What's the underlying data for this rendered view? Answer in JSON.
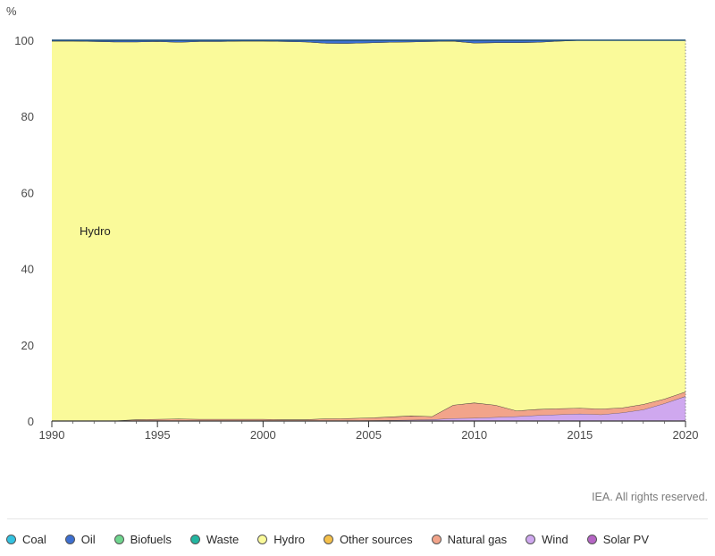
{
  "credit": "IEA. All rights reserved.",
  "chart_data": {
    "type": "area",
    "stacked": true,
    "ylabel": "%",
    "ylim": [
      0,
      100
    ],
    "yticks": [
      0,
      20,
      40,
      60,
      80,
      100
    ],
    "xlim": [
      1990,
      2020
    ],
    "xticks": [
      1990,
      1995,
      2000,
      2005,
      2010,
      2015,
      2020
    ],
    "x": [
      1990,
      1991,
      1992,
      1993,
      1994,
      1995,
      1996,
      1997,
      1998,
      1999,
      2000,
      2001,
      2002,
      2003,
      2004,
      2005,
      2006,
      2007,
      2008,
      2009,
      2010,
      2011,
      2012,
      2013,
      2014,
      2015,
      2016,
      2017,
      2018,
      2019,
      2020
    ],
    "annotation": "Hydro",
    "series": [
      {
        "name": "Solar PV",
        "color": "#b565c4",
        "values": [
          0,
          0,
          0,
          0,
          0,
          0,
          0,
          0,
          0,
          0,
          0,
          0,
          0,
          0,
          0,
          0,
          0,
          0,
          0,
          0,
          0,
          0,
          0,
          0,
          0,
          0,
          0,
          0,
          0,
          0.1,
          0.2
        ]
      },
      {
        "name": "Wind",
        "color": "#cfa8ef",
        "values": [
          0,
          0,
          0,
          0,
          0,
          0,
          0,
          0,
          0,
          0,
          0,
          0,
          0,
          0.05,
          0.1,
          0.15,
          0.2,
          0.3,
          0.4,
          0.7,
          0.8,
          1.0,
          1.2,
          1.5,
          1.7,
          1.9,
          1.7,
          2.2,
          3.0,
          4.5,
          6.3
        ]
      },
      {
        "name": "Natural gas",
        "color": "#f2a48a",
        "values": [
          0,
          0,
          0,
          0.1,
          0.4,
          0.5,
          0.6,
          0.5,
          0.5,
          0.5,
          0.5,
          0.4,
          0.4,
          0.6,
          0.6,
          0.7,
          0.9,
          1.1,
          0.8,
          3.5,
          4.0,
          3.2,
          1.5,
          1.6,
          1.6,
          1.5,
          1.5,
          1.3,
          1.4,
          1.2,
          1.2
        ]
      },
      {
        "name": "Other sources",
        "color": "#f5c04a",
        "values": [
          0,
          0,
          0,
          0,
          0,
          0,
          0,
          0,
          0,
          0,
          0,
          0,
          0,
          0,
          0,
          0,
          0,
          0,
          0,
          0,
          0,
          0,
          0,
          0,
          0,
          0,
          0,
          0,
          0,
          0,
          0
        ]
      },
      {
        "name": "Hydro",
        "color": "#fafa9a",
        "values": [
          99.8,
          99.8,
          99.7,
          99.5,
          99.2,
          99.2,
          98.9,
          99.2,
          99.2,
          99.3,
          99.3,
          99.3,
          99.2,
          98.6,
          98.5,
          98.5,
          98.4,
          98.2,
          98.5,
          95.6,
          94.5,
          95.2,
          96.7,
          96.4,
          96.5,
          96.6,
          96.8,
          96.5,
          95.6,
          94.2,
          92.3
        ]
      },
      {
        "name": "Waste",
        "color": "#22b5a0",
        "values": [
          0,
          0,
          0,
          0,
          0,
          0,
          0,
          0,
          0,
          0,
          0,
          0,
          0,
          0,
          0,
          0,
          0,
          0,
          0,
          0,
          0,
          0,
          0,
          0,
          0,
          0,
          0,
          0,
          0,
          0,
          0
        ]
      },
      {
        "name": "Biofuels",
        "color": "#6fd58e",
        "values": [
          0,
          0,
          0,
          0,
          0,
          0,
          0,
          0,
          0,
          0,
          0,
          0,
          0,
          0,
          0,
          0,
          0,
          0,
          0,
          0,
          0,
          0,
          0,
          0,
          0,
          0,
          0,
          0,
          0,
          0,
          0
        ]
      },
      {
        "name": "Oil",
        "color": "#3d6fd0",
        "values": [
          0.2,
          0.2,
          0.3,
          0.4,
          0.4,
          0.3,
          0.5,
          0.3,
          0.3,
          0.2,
          0.2,
          0.3,
          0.4,
          0.75,
          0.8,
          0.65,
          0.5,
          0.4,
          0.3,
          0.2,
          0.7,
          0.6,
          0.6,
          0.5,
          0.2,
          0,
          0,
          0,
          0,
          0,
          0
        ]
      },
      {
        "name": "Coal",
        "color": "#33c2e0",
        "values": [
          0,
          0,
          0,
          0,
          0,
          0,
          0,
          0,
          0,
          0,
          0,
          0,
          0,
          0,
          0,
          0,
          0,
          0,
          0,
          0,
          0,
          0,
          0,
          0,
          0,
          0,
          0,
          0,
          0,
          0,
          0
        ]
      }
    ],
    "legend": {
      "placement": "bottom",
      "items": [
        {
          "name": "Coal",
          "color": "#33c2e0"
        },
        {
          "name": "Oil",
          "color": "#3d6fd0"
        },
        {
          "name": "Biofuels",
          "color": "#6fd58e"
        },
        {
          "name": "Waste",
          "color": "#22b5a0"
        },
        {
          "name": "Hydro",
          "color": "#fafa9a"
        },
        {
          "name": "Other sources",
          "color": "#f5c04a"
        },
        {
          "name": "Natural gas",
          "color": "#f2a48a"
        },
        {
          "name": "Wind",
          "color": "#cfa8ef"
        },
        {
          "name": "Solar PV",
          "color": "#b565c4"
        }
      ]
    }
  }
}
